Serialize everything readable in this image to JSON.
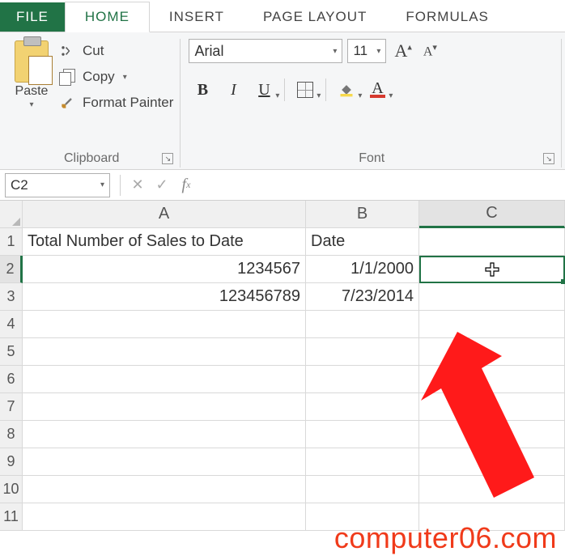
{
  "tabs": {
    "file": "FILE",
    "home": "HOME",
    "insert": "INSERT",
    "pageLayout": "PAGE LAYOUT",
    "formulas": "FORMULAS"
  },
  "clipboard": {
    "paste": "Paste",
    "cut": "Cut",
    "copy": "Copy",
    "formatPainter": "Format Painter",
    "groupLabel": "Clipboard"
  },
  "font": {
    "name": "Arial",
    "size": "11",
    "bold": "B",
    "italic": "I",
    "underline": "U",
    "fontColorLetter": "A",
    "groupLabel": "Font"
  },
  "nameBox": "C2",
  "formula": "",
  "columns": [
    "A",
    "B",
    "C"
  ],
  "rows": [
    "1",
    "2",
    "3",
    "4",
    "5",
    "6",
    "7",
    "8",
    "9",
    "10",
    "11"
  ],
  "cells": {
    "A1": "Total Number of Sales to Date",
    "B1": "Date",
    "A2": "1234567",
    "B2": "1/1/2000",
    "A3": "123456789",
    "B3": "7/23/2014"
  },
  "selectedCell": "C2",
  "watermark": "computer06.com"
}
